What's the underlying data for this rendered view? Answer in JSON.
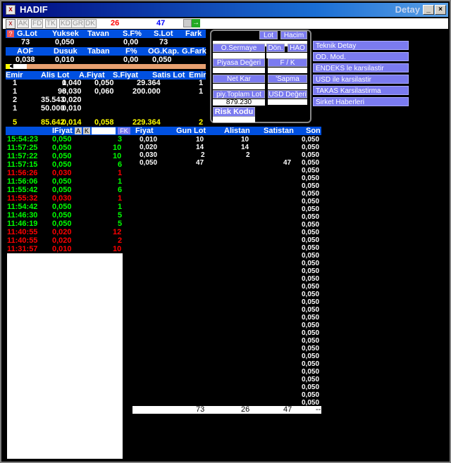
{
  "window": {
    "title": "HADIF",
    "detay": "Detay"
  },
  "toolbar": {
    "buttons": [
      "AK",
      "FD",
      "TK",
      "KD",
      "GR",
      "DK"
    ],
    "num_red": "26",
    "num_blue": "47"
  },
  "summary": {
    "headers1": [
      "G.Lot",
      "Yuksek",
      "Tavan",
      "S.F%",
      "S.Lot",
      "Fark"
    ],
    "values1": [
      "73",
      "0,050",
      "",
      "0,00",
      "73",
      ""
    ],
    "headers2": [
      "AOF",
      "Dusuk",
      "Taban",
      "F%",
      "OG.Kap.",
      "G.Fark"
    ],
    "values2": [
      "0,038",
      "0,010",
      "",
      "0,00",
      "0,050",
      ""
    ]
  },
  "depth": {
    "headers": [
      "Emir",
      "Alis Lot",
      "A.Fiyat",
      "S.Fiyat",
      "Satis Lot",
      "Emir"
    ],
    "rows": [
      [
        "1",
        "1",
        "0,040",
        "0,050",
        "29.364",
        "1"
      ],
      [
        "1",
        "98",
        "0,030",
        "0,060",
        "200.000",
        "1"
      ],
      [
        "2",
        "35.543",
        "0,020",
        "",
        "",
        ""
      ],
      [
        "1",
        "50.000",
        "0,010",
        "",
        "",
        ""
      ]
    ],
    "totals": [
      "5",
      "85.642",
      "0,014",
      "0,058",
      "229.364",
      "2"
    ]
  },
  "panel": {
    "lot": "Lot",
    "hacim": "Hacim",
    "osermaye": "O.Sermaye",
    "don": "Dön.",
    "hao": "HAO",
    "piyasa": "Piyasa Değeri",
    "fk": "F / K",
    "netkar": "Net Kar",
    "sapma": "'Sapma",
    "piytoplam": "piy.Toplam Lot",
    "piytoplam_val": "879.230",
    "usd": "USD Değeri",
    "risk": "Risk Kodu"
  },
  "links": [
    "Teknik Detay",
    "OD. Mod.",
    "ENDEKS le karsilastir",
    "USD ile karsilastir",
    "TAKAS Karsilastirma",
    "Sirket Haberleri"
  ],
  "trades": {
    "header": "IFiyat",
    "btnA": "A",
    "btnK": "K",
    "fk": "FK",
    "rows": [
      {
        "t": "15:54:23",
        "p": "0,050",
        "q": "3",
        "c": "g"
      },
      {
        "t": "11:57:25",
        "p": "0,050",
        "q": "10",
        "c": "g"
      },
      {
        "t": "11:57:22",
        "p": "0,050",
        "q": "10",
        "c": "g"
      },
      {
        "t": "11:57:15",
        "p": "0,050",
        "q": "6",
        "c": "g"
      },
      {
        "t": "11:56:26",
        "p": "0,030",
        "q": "1",
        "c": "r"
      },
      {
        "t": "11:56:06",
        "p": "0,050",
        "q": "1",
        "c": "g"
      },
      {
        "t": "11:55:42",
        "p": "0,050",
        "q": "6",
        "c": "g"
      },
      {
        "t": "11:55:32",
        "p": "0,030",
        "q": "1",
        "c": "r"
      },
      {
        "t": "11:54:42",
        "p": "0,050",
        "q": "1",
        "c": "g"
      },
      {
        "t": "11:46:30",
        "p": "0,050",
        "q": "5",
        "c": "g"
      },
      {
        "t": "11:46:19",
        "p": "0,050",
        "q": "5",
        "c": "g"
      },
      {
        "t": "11:40:55",
        "p": "0,020",
        "q": "12",
        "c": "r"
      },
      {
        "t": "11:40:55",
        "p": "0,020",
        "q": "2",
        "c": "r"
      },
      {
        "t": "11:31:57",
        "p": "0,010",
        "q": "10",
        "c": "r"
      }
    ]
  },
  "pricetable": {
    "headers": [
      "Fiyat",
      "Gun Lot",
      "Alistan",
      "Satistan",
      "Son"
    ],
    "rows": [
      [
        "0,010",
        "10",
        "10",
        "",
        "0,050"
      ],
      [
        "0,020",
        "14",
        "14",
        "",
        "0,050"
      ],
      [
        "0,030",
        "2",
        "2",
        "",
        "0,050"
      ],
      [
        "0,050",
        "47",
        "",
        "47",
        "0,050"
      ]
    ],
    "son_rest": "0,050",
    "son_count": 34,
    "totals": [
      "73",
      "26",
      "47",
      "--"
    ]
  }
}
